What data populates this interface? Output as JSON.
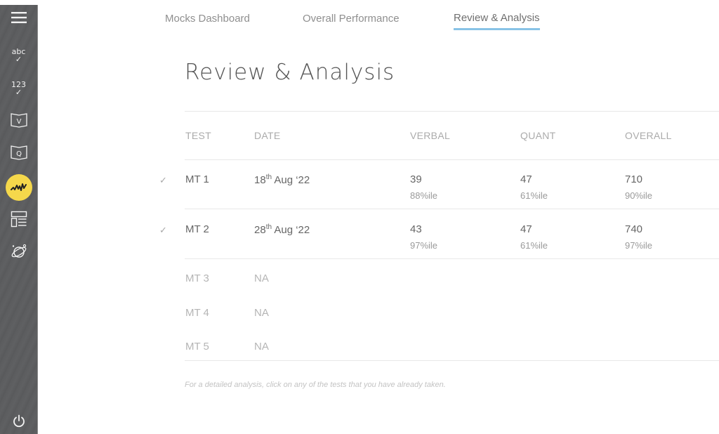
{
  "sidebar": {
    "items": [
      {
        "name": "menu",
        "icon": "hamburger-menu-icon"
      },
      {
        "name": "verbal-practice",
        "icon": "abc-check-icon",
        "label": "abc",
        "mark": "✓"
      },
      {
        "name": "quant-practice",
        "icon": "123-check-icon",
        "label": "123",
        "mark": "✓"
      },
      {
        "name": "verbal-book",
        "icon": "verbal-book-icon",
        "label": "V"
      },
      {
        "name": "quant-book",
        "icon": "quant-book-icon",
        "label": "Q"
      },
      {
        "name": "mocks-analysis",
        "icon": "pulse-wave-icon",
        "active": true
      },
      {
        "name": "layout-dashboard",
        "icon": "layout-list-icon"
      },
      {
        "name": "explore",
        "icon": "planet-icon"
      },
      {
        "name": "logout",
        "icon": "power-icon"
      }
    ],
    "active_color": "#f5d84b"
  },
  "tabs": [
    {
      "label": "Mocks Dashboard",
      "active": false
    },
    {
      "label": "Overall Performance",
      "active": false
    },
    {
      "label": "Review & Analysis",
      "active": true
    }
  ],
  "accent_color": "#88c3e6",
  "page_title": "Review & Analysis",
  "table": {
    "headers": [
      "TEST",
      "DATE",
      "VERBAL",
      "QUANT",
      "OVERALL"
    ],
    "rows": [
      {
        "completed": true,
        "test": "MT 1",
        "date_day": "18",
        "date_sup": "th",
        "date_rest": " Aug ‘22",
        "verbal": "39",
        "verbal_pct": "88%ile",
        "quant": "47",
        "quant_pct": "61%ile",
        "overall": "710",
        "overall_pct": "90%ile"
      },
      {
        "completed": true,
        "test": "MT 2",
        "date_day": "28",
        "date_sup": "th",
        "date_rest": " Aug ‘22",
        "verbal": "43",
        "verbal_pct": "97%ile",
        "quant": "47",
        "quant_pct": "61%ile",
        "overall": "740",
        "overall_pct": "97%ile"
      },
      {
        "completed": false,
        "test": "MT 3",
        "date": "NA"
      },
      {
        "completed": false,
        "test": "MT 4",
        "date": "NA"
      },
      {
        "completed": false,
        "test": "MT 5",
        "date": "NA"
      }
    ]
  },
  "footnote": "For a detailed analysis, click on any of the tests that you have already taken.",
  "check_mark": "✓"
}
